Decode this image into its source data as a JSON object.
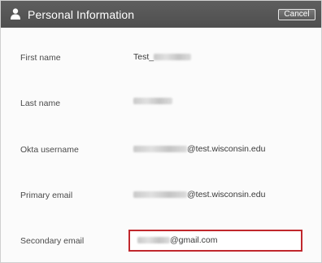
{
  "header": {
    "title": "Personal Information",
    "cancel_label": "Cancel"
  },
  "fields": [
    {
      "label": "First name",
      "value_prefix": "Test_",
      "value_suffix": ""
    },
    {
      "label": "Last name",
      "value_prefix": "",
      "value_suffix": ""
    },
    {
      "label": "Okta username",
      "value_prefix": "",
      "value_suffix": "@test.wisconsin.edu"
    },
    {
      "label": "Primary email",
      "value_prefix": "",
      "value_suffix": "@test.wisconsin.edu"
    },
    {
      "label": "Secondary email",
      "value_prefix": "",
      "value_suffix": "@gmail.com"
    }
  ],
  "colors": {
    "header_bg": "#555555",
    "highlight_border": "#c0282d"
  }
}
